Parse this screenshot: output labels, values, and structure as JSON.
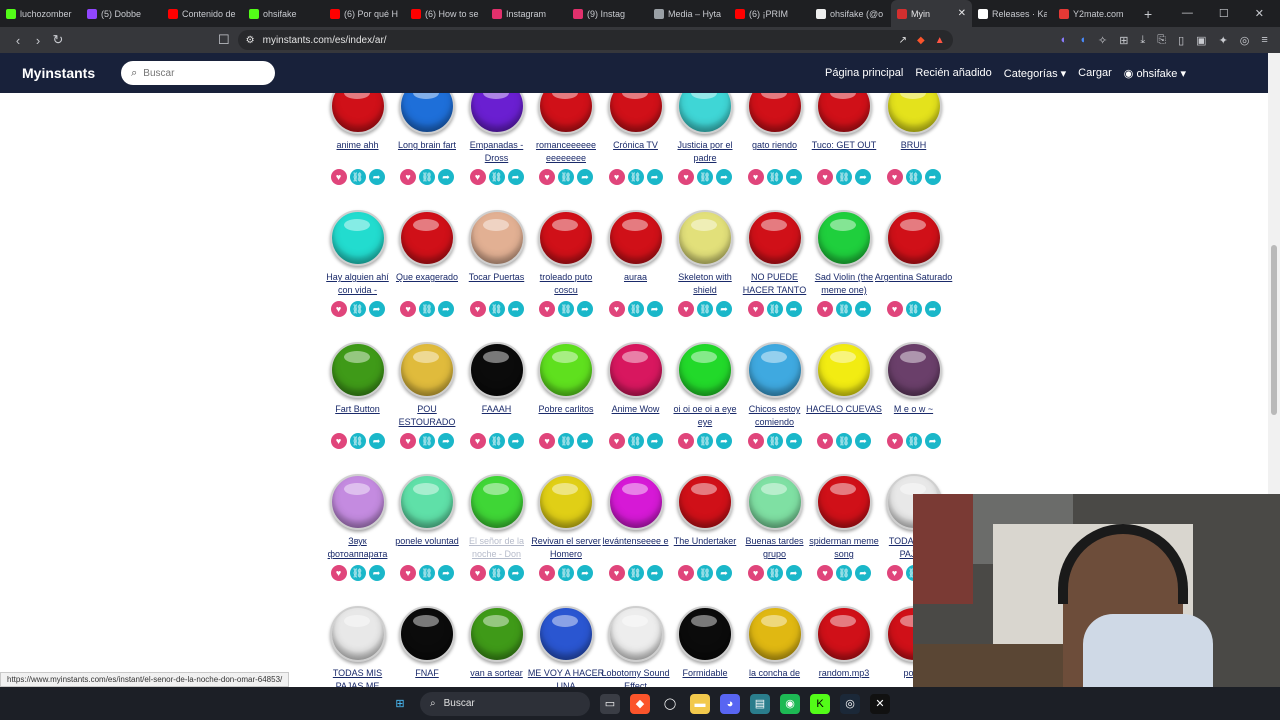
{
  "browser": {
    "tabs": [
      {
        "label": "luchozomber",
        "color": "#53fc18"
      },
      {
        "label": "(5) Dobbe",
        "color": "#9146ff"
      },
      {
        "label": "Contenido de",
        "color": "#ff0000"
      },
      {
        "label": "ohsifake",
        "color": "#53fc18"
      },
      {
        "label": "(6) Por qué H",
        "color": "#ff0000"
      },
      {
        "label": "(6) How to se",
        "color": "#ff0000"
      },
      {
        "label": "Instagram",
        "color": "#e1306c"
      },
      {
        "label": "(9) Instag",
        "color": "#e1306c"
      },
      {
        "label": "Media – Hyta",
        "color": "#9aa0a6"
      },
      {
        "label": "(6) ¡PRIM",
        "color": "#ff0000"
      },
      {
        "label": "ohsifake (@o",
        "color": "#eeeeee"
      },
      {
        "label": "Myin",
        "color": "#d32f2f",
        "active": true
      },
      {
        "label": "Releases · Ka",
        "color": "#ffffff"
      },
      {
        "label": "Y2mate.com",
        "color": "#e53935"
      }
    ],
    "new_tab": "+",
    "url": "myinstants.com/es/index/ar/"
  },
  "site": {
    "brand": "Myinstants",
    "search_placeholder": "Buscar",
    "nav": {
      "home": "Página principal",
      "recent": "Recién añadido",
      "categories": "Categorías",
      "upload": "Cargar",
      "user": "ohsifake"
    }
  },
  "buttons": [
    [
      {
        "label": "anime ahh",
        "color": "#d01018"
      },
      {
        "label": "Long brain fart",
        "color": "#1e6fd9"
      },
      {
        "label": "Empanadas - Dross",
        "color": "#6a1fd1"
      },
      {
        "label": "romanceeeeee eeeeeeee",
        "color": "#d01018"
      },
      {
        "label": "Crónica TV",
        "color": "#d01018"
      },
      {
        "label": "Justicia por el padre",
        "color": "#3fd6d6"
      },
      {
        "label": "gato riendo",
        "color": "#d01018"
      },
      {
        "label": "Tuco: GET OUT",
        "color": "#d01018"
      },
      {
        "label": "BRUH",
        "color": "#e4e21c"
      }
    ],
    [
      {
        "label": "Hay alguien ahí con vida -",
        "color": "#22dccf"
      },
      {
        "label": "Que exagerado",
        "color": "#d01018"
      },
      {
        "label": "Tocar Puertas",
        "color": "#e2b093"
      },
      {
        "label": "troleado puto coscu",
        "color": "#d01018"
      },
      {
        "label": "auraa",
        "color": "#d01018"
      },
      {
        "label": "Skeleton with shield",
        "color": "#e2e07a"
      },
      {
        "label": "NO PUEDE HACER TANTO",
        "color": "#d01018"
      },
      {
        "label": "Sad Violin (the meme one)",
        "color": "#1fcf3d"
      },
      {
        "label": "Argentina Saturado",
        "color": "#d01018"
      }
    ],
    [
      {
        "label": "Fart Button",
        "color": "#3f9a18"
      },
      {
        "label": "POU ESTOURADO",
        "color": "#e0bb3c"
      },
      {
        "label": "FAAAH",
        "color": "#0b0b0b"
      },
      {
        "label": "Pobre carlitos",
        "color": "#5fe01e"
      },
      {
        "label": "Anime Wow",
        "color": "#d8175f"
      },
      {
        "label": "oi oi oe oi a eye eye",
        "color": "#22d92a"
      },
      {
        "label": "Chicos estoy comiendo",
        "color": "#3fa9e0"
      },
      {
        "label": "HACELO CUEVAS",
        "color": "#f2ec12"
      },
      {
        "label": "M e o w ~",
        "color": "#6a3f6a"
      }
    ],
    [
      {
        "label": "Звук фотоаппарата",
        "color": "#c48be0"
      },
      {
        "label": "ponele voluntad",
        "color": "#5fe0a8"
      },
      {
        "label": "El señor de la noche - Don",
        "color": "#3fd636",
        "faded": true
      },
      {
        "label": "Revivan el server Homero",
        "color": "#e0cf16"
      },
      {
        "label": "levántenseeee e",
        "color": "#d619d6"
      },
      {
        "label": "The Undertaker",
        "color": "#d01018"
      },
      {
        "label": "Buenas tardes grupo",
        "color": "#7fe0a3"
      },
      {
        "label": "spiderman meme song",
        "color": "#d01018"
      },
      {
        "label": "TODAS MIS PAJAS",
        "color": "#e8e8e8"
      }
    ],
    [
      {
        "label": "TODAS MIS PAJAS ME",
        "color": "#e8e8e8"
      },
      {
        "label": "FNAF",
        "color": "#0b0b0b"
      },
      {
        "label": "van a sortear",
        "color": "#3f9a18"
      },
      {
        "label": "ME VOY A HACER UNA",
        "color": "#2a56d1"
      },
      {
        "label": "Lobotomy Sound Effect",
        "color": "#ededed"
      },
      {
        "label": "Formidable",
        "color": "#0b0b0b"
      },
      {
        "label": "la concha de",
        "color": "#e0b812"
      },
      {
        "label": "random.mp3",
        "color": "#d01018"
      },
      {
        "label": "pode",
        "color": "#d01018"
      }
    ]
  ],
  "icons": {
    "heart": "heart-icon",
    "link": "link-icon",
    "share": "share-icon"
  },
  "status_url": "https://www.myinstants.com/es/instant/el-senor-de-la-noche-don-omar-64853/",
  "taskbar": {
    "search_label": "Buscar"
  }
}
